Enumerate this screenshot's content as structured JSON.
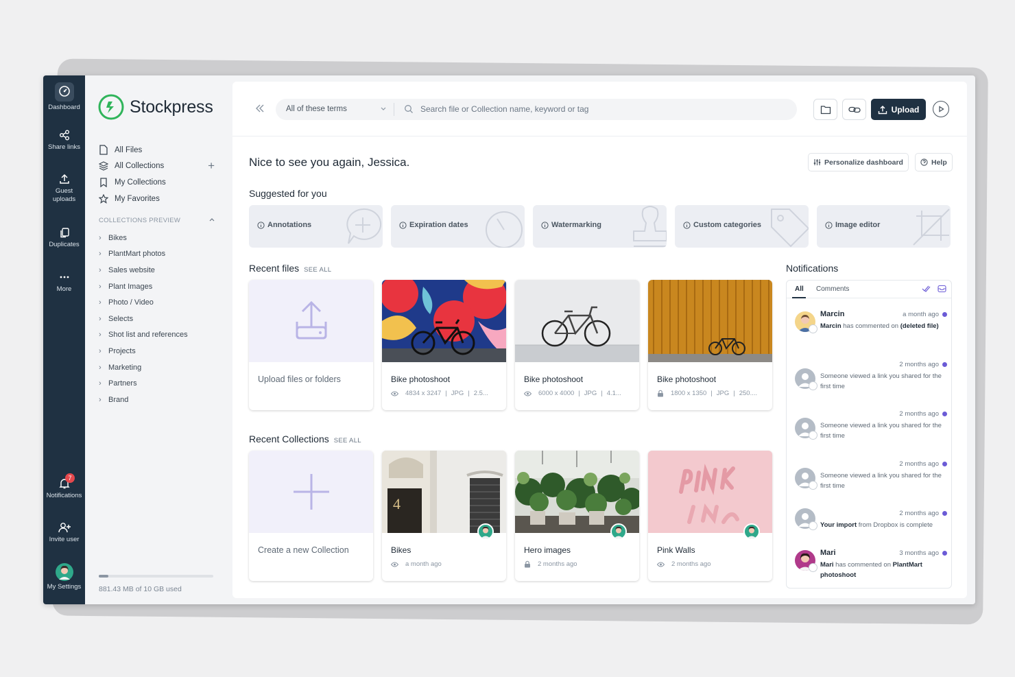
{
  "rail": {
    "items": [
      {
        "label": "Dashboard",
        "icon": "dashboard-icon"
      },
      {
        "label": "Share links",
        "icon": "share-icon"
      },
      {
        "label": "Guest uploads",
        "icon": "upload-icon"
      },
      {
        "label": "Duplicates",
        "icon": "duplicates-icon"
      },
      {
        "label": "More",
        "icon": "more-icon"
      },
      {
        "label": "Notifications",
        "icon": "bell-icon",
        "badge": "7"
      },
      {
        "label": "Invite user",
        "icon": "invite-user-icon"
      },
      {
        "label": "My Settings",
        "icon": "avatar"
      }
    ]
  },
  "sidebar": {
    "brand": "Stockpress",
    "nav": [
      {
        "label": "All Files",
        "icon": "file-icon"
      },
      {
        "label": "All Collections",
        "icon": "stack-icon"
      },
      {
        "label": "My Collections",
        "icon": "bookmark-icon"
      },
      {
        "label": "My Favorites",
        "icon": "star-icon"
      }
    ],
    "collections_header": "COLLECTIONS PREVIEW",
    "collections": [
      "Bikes",
      "PlantMart photos",
      "Sales website",
      "Plant Images",
      "Photo / Video",
      "Selects",
      "Shot list and references",
      "Projects",
      "Marketing",
      "Partners",
      "Brand"
    ],
    "storage": "881.43 MB of 10 GB used",
    "storage_fraction": 0.086
  },
  "topbar": {
    "terms": "All of these terms",
    "search_placeholder": "Search file or Collection name, keyword or tag",
    "upload": "Upload"
  },
  "main": {
    "greeting": "Nice to see you again, Jessica.",
    "personalize": "Personalize dashboard",
    "help": "Help",
    "suggested_title": "Suggested for you",
    "suggestions": [
      "Annotations",
      "Expiration dates",
      "Watermarking",
      "Custom categories",
      "Image editor"
    ],
    "recent_files_title": "Recent files",
    "see_all": "SEE ALL",
    "upload_card": "Upload files or folders",
    "files": [
      {
        "title": "Bike photoshoot",
        "dims": "4834 x 3247",
        "type": "JPG",
        "size": "2.5...",
        "access": "eye-icon"
      },
      {
        "title": "Bike photoshoot",
        "dims": "6000 x 4000",
        "type": "JPG",
        "size": "4.1...",
        "access": "eye-icon"
      },
      {
        "title": "Bike photoshoot",
        "dims": "1800 x 1350",
        "type": "JPG",
        "size": "250....",
        "access": "lock-icon"
      }
    ],
    "recent_collections_title": "Recent Collections",
    "create_card": "Create a new Collection",
    "collections": [
      {
        "title": "Bikes",
        "time": "a month ago",
        "access": "eye-icon"
      },
      {
        "title": "Hero images",
        "time": "2 months ago",
        "access": "lock-icon"
      },
      {
        "title": "Pink Walls",
        "time": "2 months ago",
        "access": "eye-icon"
      }
    ]
  },
  "notifications": {
    "title": "Notifications",
    "tabs": [
      "All",
      "Comments"
    ],
    "items": [
      {
        "name": "Marcin",
        "time": "a month ago",
        "actor": "Marcin",
        "text": " has commented on ",
        "target": "(deleted file)"
      },
      {
        "name": "",
        "time": "2 months ago",
        "actor": "",
        "text": "Someone viewed a link you shared for the first time",
        "target": ""
      },
      {
        "name": "",
        "time": "2 months ago",
        "actor": "",
        "text": "Someone viewed a link you shared for the first time",
        "target": ""
      },
      {
        "name": "",
        "time": "2 months ago",
        "actor": "",
        "text": "Someone viewed a link you shared for the first time",
        "target": ""
      },
      {
        "name": "",
        "time": "2 months ago",
        "actor": "Your import",
        "text": " from Dropbox is complete",
        "target": ""
      },
      {
        "name": "Mari",
        "time": "3 months ago",
        "actor": "Mari",
        "text": " has commented on ",
        "target": "PlantMart photoshoot"
      }
    ]
  },
  "colors": {
    "rail": "#1f3142",
    "brand_green": "#2fb45a",
    "accent_purple": "#6b5bd6",
    "upload_btn": "#1f3142"
  }
}
